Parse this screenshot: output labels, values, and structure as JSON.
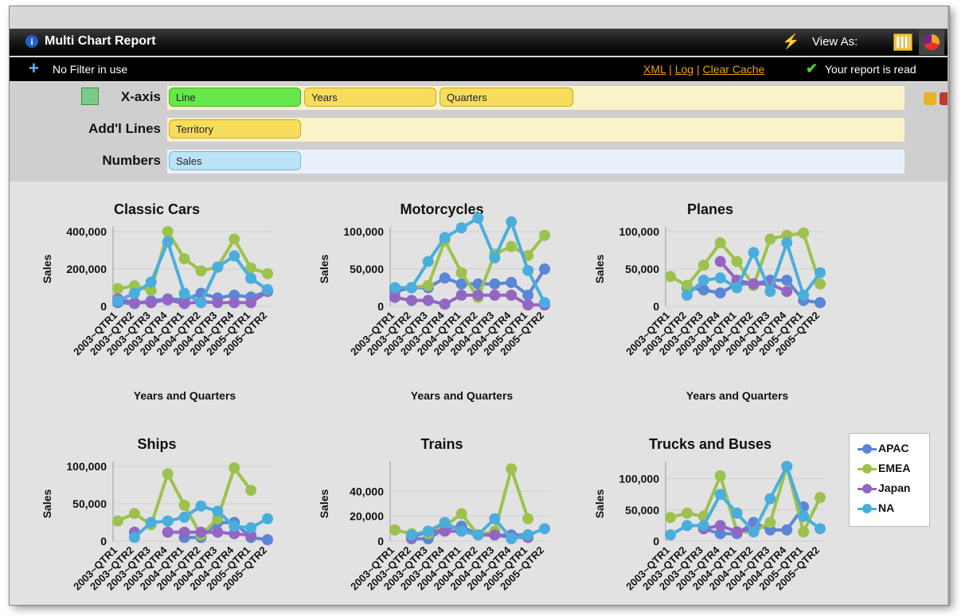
{
  "titlebar": {
    "title": "Multi Chart Report",
    "view_as": "View As:",
    "info_icon": "i"
  },
  "filterbar": {
    "no_filter": "No Filter in use",
    "link_xml": "XML",
    "link_log": "Log",
    "link_clear_cache": "Clear Cache",
    "separator": " | ",
    "status": "Your report is read"
  },
  "shelves": {
    "xaxis_label": "X-axis",
    "xaxis_pills": [
      "Line",
      "Years",
      "Quarters"
    ],
    "lines_label": "Add'l Lines",
    "lines_pills": [
      "Territory"
    ],
    "numbers_label": "Numbers",
    "numbers_pills": [
      "Sales"
    ]
  },
  "colors": {
    "APAC": "#5b86d6",
    "EMEA": "#9cc24d",
    "Japan": "#9466c4",
    "NA": "#4aaedc",
    "pill_yellow": "#f7dd5c",
    "pill_green": "#66e84a",
    "pill_blue": "#bde3f7"
  },
  "legend": [
    "APAC",
    "EMEA",
    "Japan",
    "NA"
  ],
  "chart_data": [
    {
      "type": "line",
      "title": "Classic Cars",
      "xlabel": "Years and Quarters",
      "ylabel": "Sales",
      "ylim": [
        0,
        400000
      ],
      "yticks": [
        "0",
        "200,000",
        "400,000"
      ],
      "x": [
        "2003-Q1",
        "2003-Q2",
        "2003-Q3",
        "2003-Q4",
        "2004-Q1",
        "2004-Q2",
        "2004-Q3",
        "2004-Q4",
        "2005-Q1",
        "2005-Q2"
      ],
      "x_tick_labels": [
        "2003~QTR1",
        "2003~QTR2",
        "2003~QTR3",
        "2003~QTR4",
        "2004~QTR1",
        "2004~QTR2",
        "2004~QTR3",
        "2004~QTR4",
        "2005~QTR1",
        "2005~QTR2"
      ],
      "series": [
        {
          "name": "APAC",
          "values": [
            20000,
            15000,
            30000,
            40000,
            35000,
            70000,
            45000,
            60000,
            50000,
            80000
          ]
        },
        {
          "name": "EMEA",
          "values": [
            95000,
            110000,
            85000,
            400000,
            255000,
            190000,
            210000,
            360000,
            205000,
            175000
          ]
        },
        {
          "name": "Japan",
          "values": [
            40000,
            20000,
            20000,
            35000,
            15000,
            25000,
            20000,
            20000,
            20000,
            80000
          ]
        },
        {
          "name": "NA",
          "values": [
            30000,
            70000,
            130000,
            345000,
            70000,
            20000,
            210000,
            270000,
            150000,
            90000
          ]
        }
      ]
    },
    {
      "type": "line",
      "title": "Motorcycles",
      "xlabel": "Years and Quarters",
      "ylabel": "Sales",
      "ylim": [
        0,
        100000
      ],
      "yticks": [
        "0",
        "50,000",
        "100,000"
      ],
      "x": [
        "2003-Q1",
        "2003-Q2",
        "2003-Q3",
        "2003-Q4",
        "2004-Q1",
        "2004-Q2",
        "2004-Q3",
        "2004-Q4",
        "2005-Q1",
        "2005-Q2"
      ],
      "x_tick_labels": [
        "2003~QTR1",
        "2003~QTR2",
        "2003~QTR3",
        "2003~QTR4",
        "2004~QTR1",
        "2004~QTR2",
        "2004~QTR3",
        "2004~QTR4",
        "2005~QTR1",
        "2005~QTR2"
      ],
      "series": [
        {
          "name": "APAC",
          "values": [
            20000,
            25000,
            25000,
            38000,
            30000,
            30000,
            30000,
            32000,
            15000,
            50000
          ]
        },
        {
          "name": "EMEA",
          "values": [
            25000,
            25000,
            28000,
            88000,
            45000,
            12000,
            70000,
            80000,
            68000,
            95000
          ]
        },
        {
          "name": "Japan",
          "values": [
            12000,
            8000,
            8000,
            3000,
            15000,
            15000,
            15000,
            15000,
            2000,
            2000
          ]
        },
        {
          "name": "NA",
          "values": [
            25000,
            25000,
            60000,
            92000,
            105000,
            118000,
            65000,
            113000,
            48000,
            5000
          ]
        }
      ]
    },
    {
      "type": "line",
      "title": "Planes",
      "xlabel": "Years and Quarters",
      "ylabel": "Sales",
      "ylim": [
        0,
        100000
      ],
      "yticks": [
        "0",
        "50,000",
        "100,000"
      ],
      "x": [
        "2003-Q1",
        "2003-Q2",
        "2003-Q3",
        "2003-Q4",
        "2004-Q1",
        "2004-Q2",
        "2004-Q3",
        "2004-Q4",
        "2005-Q1",
        "2005-Q2"
      ],
      "x_tick_labels": [
        "2003~QTR1",
        "2003~QTR2",
        "2003~QTR3",
        "2003~QTR4",
        "2004~QTR1",
        "2004~QTR2",
        "2004~QTR3",
        "2004~QTR4",
        "2005~QTR1",
        "2005~QTR2"
      ],
      "series": [
        {
          "name": "APAC",
          "values": [
            null,
            25000,
            22000,
            18000,
            30000,
            30000,
            35000,
            35000,
            8000,
            5000
          ]
        },
        {
          "name": "EMEA",
          "values": [
            40000,
            28000,
            55000,
            85000,
            60000,
            28000,
            90000,
            95000,
            98000,
            30000
          ]
        },
        {
          "name": "Japan",
          "values": [
            null,
            null,
            null,
            60000,
            35000,
            30000,
            30000,
            20000,
            null,
            null
          ]
        },
        {
          "name": "NA",
          "values": [
            null,
            15000,
            35000,
            38000,
            25000,
            72000,
            20000,
            85000,
            15000,
            45000
          ]
        }
      ]
    },
    {
      "type": "line",
      "title": "Ships",
      "xlabel": "",
      "ylabel": "Sales",
      "ylim": [
        0,
        100000
      ],
      "yticks": [
        "0",
        "50,000",
        "100,000"
      ],
      "x": [
        "2003-Q1",
        "2003-Q2",
        "2003-Q3",
        "2003-Q4",
        "2004-Q1",
        "2004-Q2",
        "2004-Q3",
        "2004-Q4",
        "2005-Q1",
        "2005-Q2"
      ],
      "x_tick_labels": [
        "2003~QTR1",
        "2003~QTR2",
        "2003~QTR3",
        "2003~QTR4",
        "2004~QTR1",
        "2004~QTR2",
        "2004~QTR3",
        "2004~QTR4",
        "2005~QTR1",
        "2005~QTR2"
      ],
      "series": [
        {
          "name": "APAC",
          "values": [
            null,
            null,
            null,
            null,
            5000,
            5000,
            25000,
            25000,
            5000,
            2000
          ]
        },
        {
          "name": "EMEA",
          "values": [
            27000,
            37000,
            22000,
            90000,
            48000,
            8000,
            30000,
            98000,
            68000,
            null
          ]
        },
        {
          "name": "Japan",
          "values": [
            null,
            12000,
            null,
            12000,
            12000,
            12000,
            12000,
            10000,
            8000,
            null
          ]
        },
        {
          "name": "NA",
          "values": [
            null,
            5000,
            25000,
            27000,
            32000,
            47000,
            40000,
            20000,
            18000,
            30000
          ]
        }
      ]
    },
    {
      "type": "line",
      "title": "Trains",
      "xlabel": "",
      "ylabel": "Sales",
      "ylim": [
        0,
        60000
      ],
      "yticks": [
        "0",
        "20,000",
        "40,000"
      ],
      "x": [
        "2003-Q1",
        "2003-Q2",
        "2003-Q3",
        "2003-Q4",
        "2004-Q1",
        "2004-Q2",
        "2004-Q3",
        "2004-Q4",
        "2005-Q1",
        "2005-Q2"
      ],
      "x_tick_labels": [
        "2003~QTR1",
        "2003~QTR2",
        "2003~QTR3",
        "2003~QTR4",
        "2004~QTR1",
        "2004~QTR2",
        "2004~QTR3",
        "2004~QTR4",
        "2005~QTR1",
        "2005~QTR2"
      ],
      "series": [
        {
          "name": "APAC",
          "values": [
            null,
            2000,
            2000,
            10000,
            12000,
            5000,
            5000,
            5000,
            5000,
            null
          ]
        },
        {
          "name": "EMEA",
          "values": [
            9000,
            6000,
            6000,
            12000,
            22000,
            5000,
            8000,
            58000,
            18000,
            null
          ]
        },
        {
          "name": "Japan",
          "values": [
            null,
            3000,
            8000,
            8000,
            8000,
            5000,
            5000,
            3000,
            3000,
            null
          ]
        },
        {
          "name": "NA",
          "values": [
            null,
            5000,
            8000,
            15000,
            8000,
            5000,
            18000,
            2000,
            5000,
            10000
          ]
        }
      ]
    },
    {
      "type": "line",
      "title": "Trucks and Buses",
      "xlabel": "",
      "ylabel": "Sales",
      "ylim": [
        0,
        120000
      ],
      "yticks": [
        "0",
        "50,000",
        "100,000"
      ],
      "x": [
        "2003-Q1",
        "2003-Q2",
        "2003-Q3",
        "2003-Q4",
        "2004-Q1",
        "2004-Q2",
        "2004-Q3",
        "2004-Q4",
        "2005-Q1",
        "2005-Q2"
      ],
      "x_tick_labels": [
        "2003~QTR1",
        "2003~QTR2",
        "2003~QTR3",
        "2003~QTR4",
        "2004~QTR1",
        "2004~QTR2",
        "2004~QTR3",
        "2004~QTR4",
        "2005~QTR1",
        "2005~QTR2"
      ],
      "series": [
        {
          "name": "APAC",
          "values": [
            null,
            null,
            20000,
            12000,
            12000,
            30000,
            18000,
            18000,
            55000,
            null
          ]
        },
        {
          "name": "EMEA",
          "values": [
            38000,
            45000,
            40000,
            105000,
            15000,
            15000,
            30000,
            120000,
            15000,
            70000
          ]
        },
        {
          "name": "Japan",
          "values": [
            null,
            null,
            20000,
            25000,
            15000,
            20000,
            null,
            null,
            40000,
            null
          ]
        },
        {
          "name": "NA",
          "values": [
            10000,
            25000,
            25000,
            75000,
            45000,
            15000,
            68000,
            120000,
            40000,
            20000
          ]
        }
      ]
    }
  ]
}
